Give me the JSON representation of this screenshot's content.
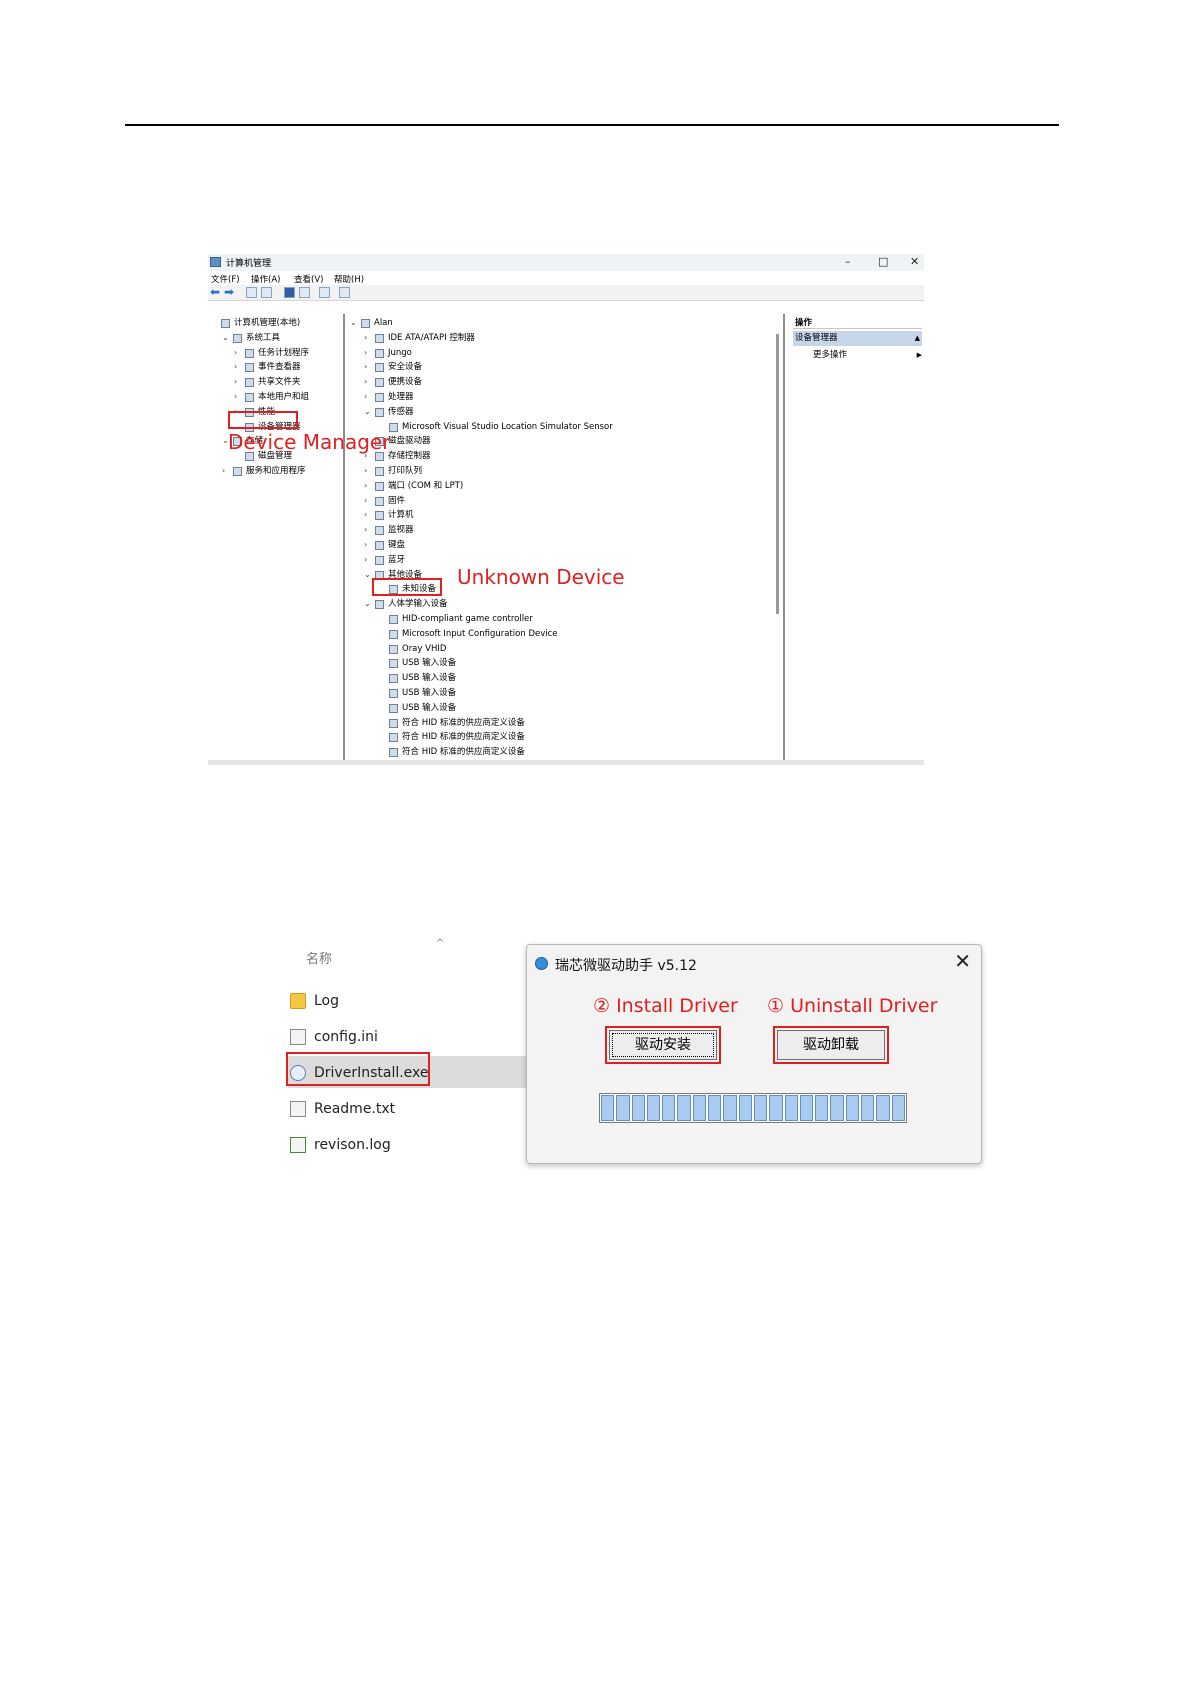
{
  "window": {
    "title": "计算机管理",
    "controls": {
      "minimize": "–",
      "maximize": "□",
      "close": "✕"
    },
    "menu": [
      "文件(F)",
      "操作(A)",
      "查看(V)",
      "帮助(H)"
    ]
  },
  "left_tree": [
    {
      "label": "计算机管理(本地)",
      "chevron": "",
      "indent": 0
    },
    {
      "label": "系统工具",
      "chevron": "⌄",
      "indent": 1
    },
    {
      "label": "任务计划程序",
      "chevron": "›",
      "indent": 2
    },
    {
      "label": "事件查看器",
      "chevron": "›",
      "indent": 2
    },
    {
      "label": "共享文件夹",
      "chevron": "›",
      "indent": 2
    },
    {
      "label": "本地用户和组",
      "chevron": "›",
      "indent": 2
    },
    {
      "label": "性能",
      "chevron": "›",
      "indent": 2
    },
    {
      "label": "设备管理器",
      "chevron": "",
      "indent": 2
    },
    {
      "label": "存储",
      "chevron": "⌄",
      "indent": 1
    },
    {
      "label": "磁盘管理",
      "chevron": "",
      "indent": 2
    },
    {
      "label": "服务和应用程序",
      "chevron": "›",
      "indent": 1
    }
  ],
  "device_tree": [
    {
      "label": "Alan",
      "chevron": "⌄",
      "indent": 0
    },
    {
      "label": "IDE ATA/ATAPI 控制器",
      "chevron": "›",
      "indent": 1
    },
    {
      "label": "Jungo",
      "chevron": "›",
      "indent": 1
    },
    {
      "label": "安全设备",
      "chevron": "›",
      "indent": 1
    },
    {
      "label": "便携设备",
      "chevron": "›",
      "indent": 1
    },
    {
      "label": "处理器",
      "chevron": "›",
      "indent": 1
    },
    {
      "label": "传感器",
      "chevron": "⌄",
      "indent": 1
    },
    {
      "label": "Microsoft Visual Studio Location Simulator Sensor",
      "chevron": "",
      "indent": 2
    },
    {
      "label": "磁盘驱动器",
      "chevron": "›",
      "indent": 1
    },
    {
      "label": "存储控制器",
      "chevron": "›",
      "indent": 1
    },
    {
      "label": "打印队列",
      "chevron": "›",
      "indent": 1
    },
    {
      "label": "端口 (COM 和 LPT)",
      "chevron": "›",
      "indent": 1
    },
    {
      "label": "固件",
      "chevron": "›",
      "indent": 1
    },
    {
      "label": "计算机",
      "chevron": "›",
      "indent": 1
    },
    {
      "label": "监视器",
      "chevron": "›",
      "indent": 1
    },
    {
      "label": "键盘",
      "chevron": "›",
      "indent": 1
    },
    {
      "label": "蓝牙",
      "chevron": "›",
      "indent": 1
    },
    {
      "label": "其他设备",
      "chevron": "⌄",
      "indent": 1
    },
    {
      "label": "未知设备",
      "chevron": "",
      "indent": 2
    },
    {
      "label": "人体学输入设备",
      "chevron": "⌄",
      "indent": 1
    },
    {
      "label": "HID-compliant game controller",
      "chevron": "",
      "indent": 2
    },
    {
      "label": "Microsoft Input Configuration Device",
      "chevron": "",
      "indent": 2
    },
    {
      "label": "Oray VHID",
      "chevron": "",
      "indent": 2
    },
    {
      "label": "USB 输入设备",
      "chevron": "",
      "indent": 2
    },
    {
      "label": "USB 输入设备",
      "chevron": "",
      "indent": 2
    },
    {
      "label": "USB 输入设备",
      "chevron": "",
      "indent": 2
    },
    {
      "label": "USB 输入设备",
      "chevron": "",
      "indent": 2
    },
    {
      "label": "符合 HID 标准的供应商定义设备",
      "chevron": "",
      "indent": 2
    },
    {
      "label": "符合 HID 标准的供应商定义设备",
      "chevron": "",
      "indent": 2
    },
    {
      "label": "符合 HID 标准的供应商定义设备",
      "chevron": "",
      "indent": 2
    }
  ],
  "actions": {
    "header": "操作",
    "selected": "设备管理器",
    "more": "更多操作",
    "collapse_glyph": "▲",
    "more_glyph": "▶"
  },
  "annotations": {
    "device_manager": "Device Manager",
    "unknown_device": "Unknown Device",
    "install_driver": "② Install Driver",
    "uninstall_driver": "① Uninstall Driver"
  },
  "file_list": {
    "column_header": "名称",
    "sort_glyph": "^",
    "items": [
      "Log",
      "config.ini",
      "DriverInstall.exe",
      "Readme.txt",
      "revison.log"
    ]
  },
  "driver_dialog": {
    "title": "瑞芯微驱动助手 v5.12",
    "close": "✕",
    "install_button": "驱动安装",
    "uninstall_button": "驱动卸载",
    "progress_segments": 20,
    "progress": 1.0
  },
  "colors": {
    "annotation": "#e02020",
    "selection": "#c5d6ea",
    "progress_fill": "#a9cbef"
  }
}
